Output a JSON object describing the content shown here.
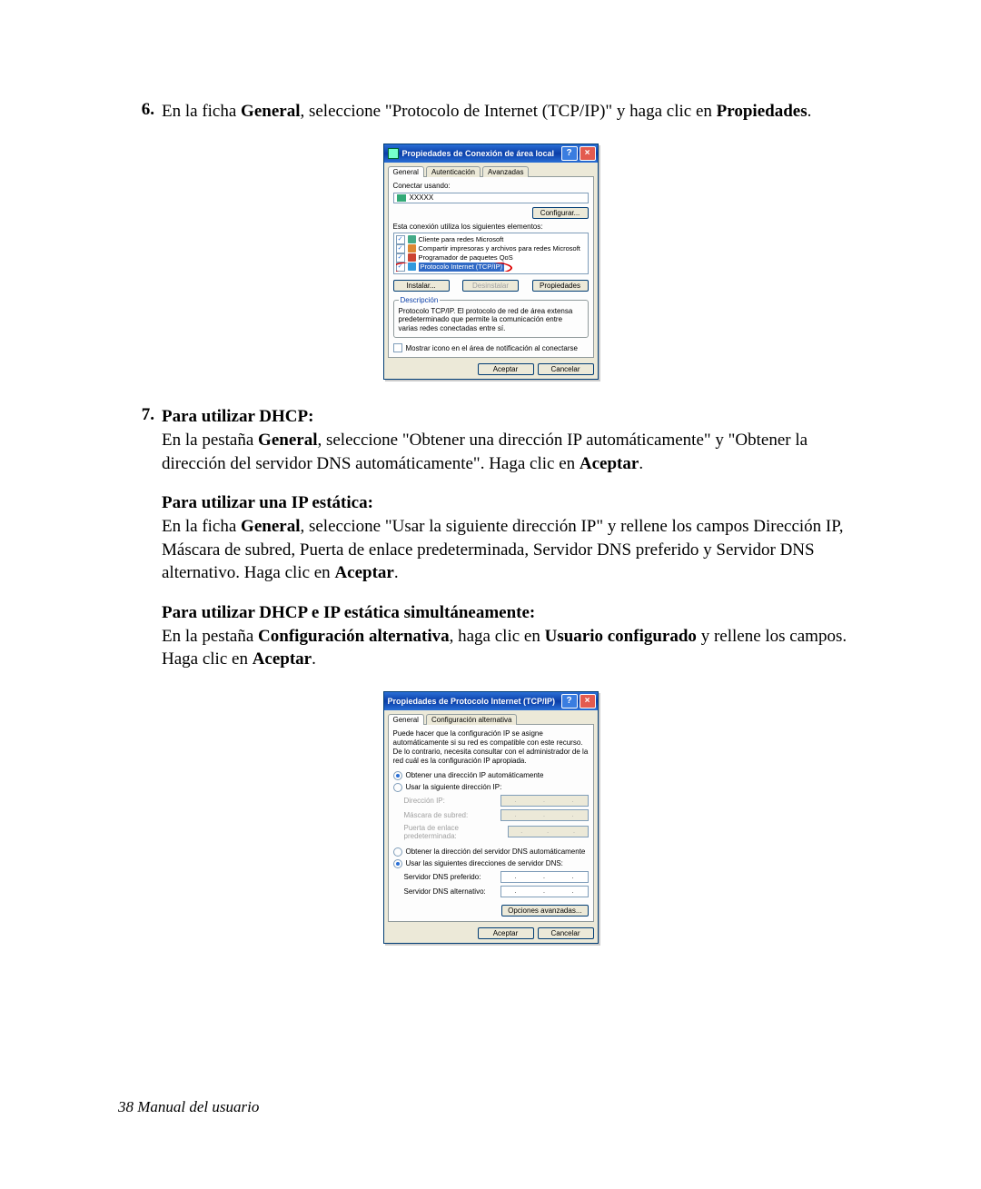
{
  "steps": {
    "s6": {
      "num": "6.",
      "text_a": "En la ficha ",
      "bold_a": "General",
      "text_b": ", seleccione \"Protocolo de Internet (TCP/IP)\" y haga clic en ",
      "bold_b": "Propiedades",
      "text_c": "."
    },
    "s7": {
      "num": "7.",
      "h1": "Para utilizar DHCP:",
      "p1_a": "En la pestaña ",
      "p1_b": "General",
      "p1_c": ", seleccione \"Obtener una dirección IP automáticamente\" y \"Obtener la dirección del servidor DNS automáticamente\". Haga clic en ",
      "p1_d": "Aceptar",
      "p1_e": ".",
      "h2": "Para utilizar una IP estática:",
      "p2_a": "En la ficha ",
      "p2_b": "General",
      "p2_c": ", seleccione \"Usar la siguiente dirección IP\" y rellene los campos Dirección IP, Máscara de subred, Puerta de enlace predeterminada, Servidor DNS preferido y Servidor DNS alternativo. Haga clic en ",
      "p2_d": "Aceptar",
      "p2_e": ".",
      "h3": "Para utilizar DHCP e IP estática simultáneamente:",
      "p3_a": "En la pestaña ",
      "p3_b": "Configuración alternativa",
      "p3_c": ", haga clic en ",
      "p3_d": "Usuario configurado",
      "p3_e": " y rellene los campos. Haga clic en ",
      "p3_f": "Aceptar",
      "p3_g": "."
    }
  },
  "dlg1": {
    "title": "Propiedades de Conexión de área local",
    "tabs": {
      "general": "General",
      "auth": "Autenticación",
      "adv": "Avanzadas"
    },
    "connect_using": "Conectar usando:",
    "adapter": "XXXXX",
    "configure": "Configurar...",
    "uses_elements": "Esta conexión utiliza los siguientes elementos:",
    "items": {
      "a": "Cliente para redes Microsoft",
      "b": "Compartir impresoras y archivos para redes Microsoft",
      "c": "Programador de paquetes QoS",
      "d": "Protocolo Internet (TCP/IP)"
    },
    "install": "Instalar...",
    "uninstall": "Desinstalar",
    "properties": "Propiedades",
    "desc_legend": "Descripción",
    "desc_text": "Protocolo TCP/IP. El protocolo de red de área extensa predeterminado que permite la comunicación entre varias redes conectadas entre sí.",
    "notify": "Mostrar icono en el área de notificación al conectarse",
    "ok": "Aceptar",
    "cancel": "Cancelar"
  },
  "dlg2": {
    "title": "Propiedades de Protocolo Internet (TCP/IP)",
    "tabs": {
      "general": "General",
      "alt": "Configuración alternativa"
    },
    "intro": "Puede hacer que la configuración IP se asigne automáticamente si su red es compatible con este recurso. De lo contrario, necesita consultar con el administrador de la red cuál es la configuración IP apropiada.",
    "r1": "Obtener una dirección IP automáticamente",
    "r2": "Usar la siguiente dirección IP:",
    "ip": "Dirección IP:",
    "mask": "Máscara de subred:",
    "gw": "Puerta de enlace predeterminada:",
    "r3": "Obtener la dirección del servidor DNS automáticamente",
    "r4": "Usar las siguientes direcciones de servidor DNS:",
    "dns1": "Servidor DNS preferido:",
    "dns2": "Servidor DNS alternativo:",
    "advanced": "Opciones avanzadas...",
    "ok": "Aceptar",
    "cancel": "Cancelar"
  },
  "footer": "38  Manual del usuario"
}
